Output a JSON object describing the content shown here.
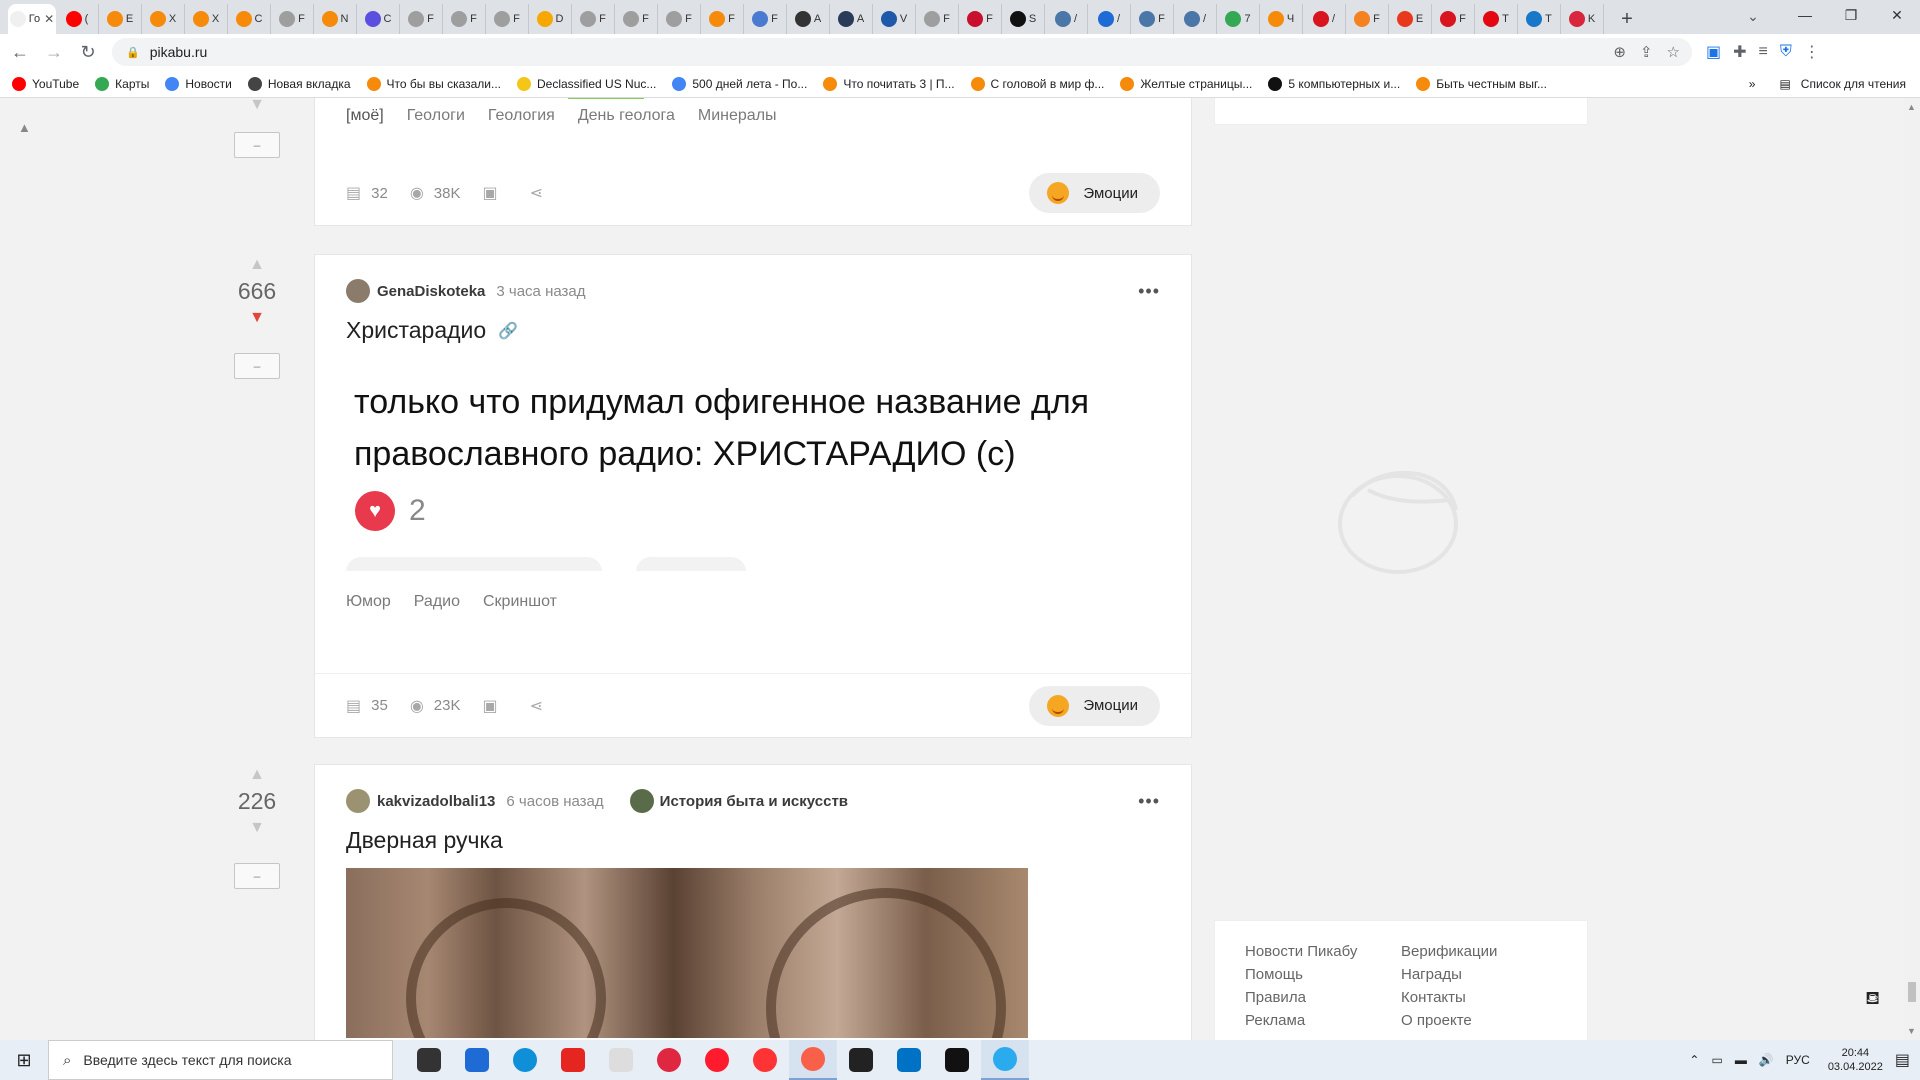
{
  "browser": {
    "active_tab_label": "Го",
    "tabs": [
      {
        "label": "Го",
        "color": "#f0f0f0",
        "active": true
      },
      {
        "label": "(",
        "color": "#ff0000"
      },
      {
        "label": "E",
        "color": "#f58a0b"
      },
      {
        "label": "Х",
        "color": "#f58a0b"
      },
      {
        "label": "Х",
        "color": "#f58a0b"
      },
      {
        "label": "С",
        "color": "#f58a0b"
      },
      {
        "label": "F",
        "color": "#9e9e9e"
      },
      {
        "label": "N",
        "color": "#f58a0b"
      },
      {
        "label": "С",
        "color": "#5b4fe0"
      },
      {
        "label": "F",
        "color": "#9e9e9e"
      },
      {
        "label": "F",
        "color": "#9e9e9e"
      },
      {
        "label": "F",
        "color": "#9e9e9e"
      },
      {
        "label": "D",
        "color": "#f7a800"
      },
      {
        "label": "F",
        "color": "#9e9e9e"
      },
      {
        "label": "F",
        "color": "#9e9e9e"
      },
      {
        "label": "F",
        "color": "#9e9e9e"
      },
      {
        "label": "F",
        "color": "#f58a0b"
      },
      {
        "label": "F",
        "color": "#4a7bd1"
      },
      {
        "label": "A",
        "color": "#333333"
      },
      {
        "label": "A",
        "color": "#2a3b5a"
      },
      {
        "label": "V",
        "color": "#1e5aa8"
      },
      {
        "label": "F",
        "color": "#9e9e9e"
      },
      {
        "label": "F",
        "color": "#c8102e"
      },
      {
        "label": "S",
        "color": "#111111"
      },
      {
        "label": "/",
        "color": "#4a76a8"
      },
      {
        "label": "/",
        "color": "#1e6bd6"
      },
      {
        "label": "F",
        "color": "#4a76a8"
      },
      {
        "label": "/",
        "color": "#4a76a8"
      },
      {
        "label": "7",
        "color": "#34a853"
      },
      {
        "label": "Ч",
        "color": "#f58a0b"
      },
      {
        "label": "/",
        "color": "#d8141f"
      },
      {
        "label": "F",
        "color": "#f58220"
      },
      {
        "label": "E",
        "color": "#e8391d"
      },
      {
        "label": "F",
        "color": "#d8141f"
      },
      {
        "label": "T",
        "color": "#e30613"
      },
      {
        "label": "T",
        "color": "#1877c8"
      },
      {
        "label": "K",
        "color": "#d7263d"
      }
    ],
    "new_tab": "+",
    "url": "pikabu.ru",
    "bookmarks": [
      {
        "label": "YouTube",
        "color": "#ff0000"
      },
      {
        "label": "Карты",
        "color": "#34a853"
      },
      {
        "label": "Новости",
        "color": "#4285f4"
      },
      {
        "label": "Новая вкладка",
        "color": "#444444"
      },
      {
        "label": "Что бы вы сказали...",
        "color": "#f58a0b"
      },
      {
        "label": "Declassified US Nuc...",
        "color": "#f5c518"
      },
      {
        "label": "500 дней лета - По...",
        "color": "#4285f4"
      },
      {
        "label": "Что почитать 3 | П...",
        "color": "#f58a0b"
      },
      {
        "label": "С головой в мир ф...",
        "color": "#f58a0b"
      },
      {
        "label": "Желтые страницы...",
        "color": "#f58a0b"
      },
      {
        "label": "5 компьютерных и...",
        "color": "#111111"
      },
      {
        "label": "Быть честным выг...",
        "color": "#f58a0b"
      }
    ],
    "bookmarks_more": "»",
    "reading_list": "Список для чтения"
  },
  "posts": [
    {
      "tags": [
        "[моё]",
        "Геологи",
        "Геология",
        "День геолога",
        "Минералы"
      ],
      "comments": "32",
      "views": "38K",
      "emotions_label": "Эмоции",
      "minus_label": "–"
    },
    {
      "score": "666",
      "author": "GenaDiskoteka",
      "time": "3 часа назад",
      "title": "Христарадио",
      "screenshot_text": "только что придумал офигенное название для православного радио: ХРИСТАРАДИО (с)",
      "reactions_count": "2",
      "tags": [
        "Юмор",
        "Радио",
        "Скриншот"
      ],
      "comments": "35",
      "views": "23K",
      "emotions_label": "Эмоции",
      "minus_label": "–"
    },
    {
      "score": "226",
      "author": "kakvizadolbali13",
      "time": "6 часов назад",
      "community": "История быта и искусств",
      "title": "Дверная ручка",
      "minus_label": "–"
    }
  ],
  "sidebar": {
    "footer_links": [
      "Новости Пикабу",
      "Верификации",
      "Помощь",
      "Награды",
      "Правила",
      "Контакты",
      "Реклама",
      "О проекте"
    ]
  },
  "taskbar": {
    "search_placeholder": "Введите здесь текст для поиска",
    "language": "РУС",
    "time": "20:44",
    "date": "03.04.2022",
    "apps": [
      {
        "name": "task-view",
        "color": "#333333"
      },
      {
        "name": "store",
        "color": "#1e6bd6"
      },
      {
        "name": "edge",
        "color": "#0f8fd8"
      },
      {
        "name": "yandex",
        "color": "#e52620"
      },
      {
        "name": "file",
        "color": "#dddddd"
      },
      {
        "name": "opera-gx",
        "color": "#e02742"
      },
      {
        "name": "opera",
        "color": "#ff1b2d"
      },
      {
        "name": "yandex-browser",
        "color": "#ff3333"
      },
      {
        "name": "yandex-music",
        "color": "#f8604a"
      },
      {
        "name": "app-dark",
        "color": "#222222"
      },
      {
        "name": "mail",
        "color": "#0072c6"
      },
      {
        "name": "tiktok",
        "color": "#111111"
      },
      {
        "name": "telegram",
        "color": "#2aabee"
      }
    ]
  }
}
